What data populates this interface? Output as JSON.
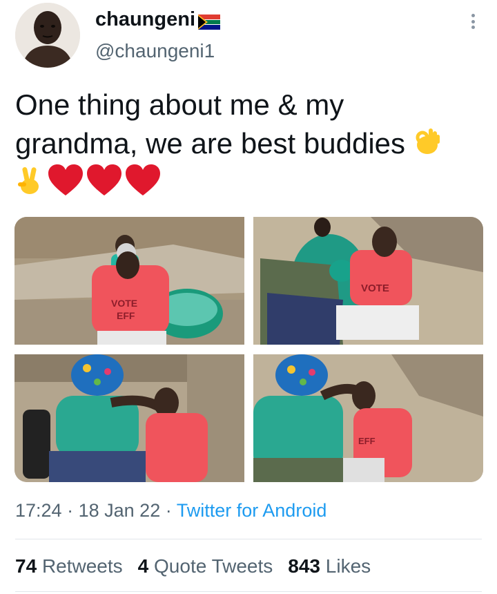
{
  "tweet": {
    "display_name": "chaungeni",
    "flag_icon": "south-africa-flag-icon",
    "handle": "@chaungeni1",
    "text_line1": "One thing about me & my",
    "text_line2": "grandma, we are best buddies",
    "emoji_ok": "ok-hand-icon",
    "emoji_victory": "victory-hand-icon",
    "emoji_hearts": [
      "red-heart-icon",
      "red-heart-icon",
      "red-heart-icon"
    ],
    "time": "17:24",
    "date": "18 Jan 22",
    "source": "Twitter for Android",
    "separator": "·"
  },
  "stats": {
    "retweets_count": "74",
    "retweets_label": "Retweets",
    "quotes_count": "4",
    "quotes_label": "Quote Tweets",
    "likes_count": "843",
    "likes_label": "Likes"
  },
  "media": {
    "photos": [
      {
        "shirt_text": "VOTE EFF"
      },
      {
        "shirt_text": "VOTE"
      },
      {
        "shirt_text": ""
      },
      {
        "shirt_text": "EFF"
      }
    ]
  },
  "colors": {
    "link": "#1d9bf0",
    "secondary_text": "#536471",
    "heart": "#e0182d",
    "shirt": "#f0545c"
  }
}
